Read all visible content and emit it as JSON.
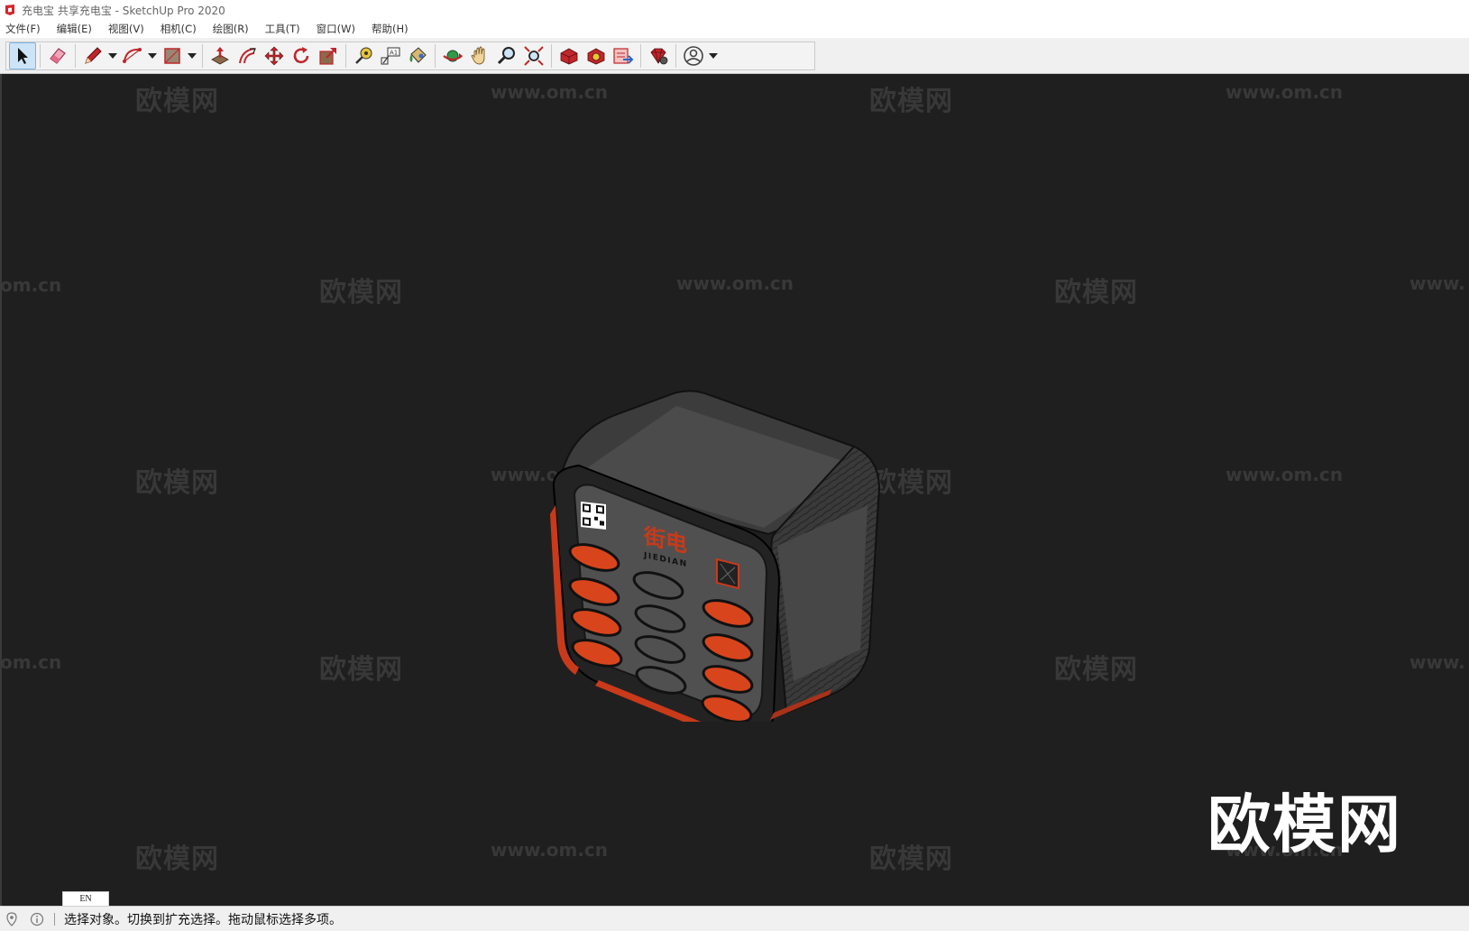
{
  "window": {
    "title": "充电宝 共享充电宝 - SketchUp Pro 2020"
  },
  "menu": {
    "items": [
      {
        "id": "file",
        "label": "文件(F)"
      },
      {
        "id": "edit",
        "label": "编辑(E)"
      },
      {
        "id": "view",
        "label": "视图(V)"
      },
      {
        "id": "camera",
        "label": "相机(C)"
      },
      {
        "id": "draw",
        "label": "绘图(R)"
      },
      {
        "id": "tools",
        "label": "工具(T)"
      },
      {
        "id": "window",
        "label": "窗口(W)"
      },
      {
        "id": "help",
        "label": "帮助(H)"
      }
    ]
  },
  "toolbar": {
    "tools": [
      {
        "name": "select-tool",
        "icon": "arrow-cursor-icon",
        "active": true
      },
      {
        "name": "eraser-tool",
        "icon": "eraser-icon"
      },
      {
        "name": "line-tool",
        "icon": "pencil-icon",
        "has_dropdown": true
      },
      {
        "name": "arc-tool",
        "icon": "arc-icon",
        "has_dropdown": true
      },
      {
        "name": "rectangle-tool",
        "icon": "rectangle-icon",
        "has_dropdown": true
      },
      {
        "name": "push-pull-tool",
        "icon": "push-pull-icon"
      },
      {
        "name": "offset-tool",
        "icon": "offset-icon"
      },
      {
        "name": "move-tool",
        "icon": "move-icon"
      },
      {
        "name": "rotate-tool",
        "icon": "rotate-icon"
      },
      {
        "name": "scale-tool",
        "icon": "scale-icon"
      },
      {
        "name": "tape-measure-tool",
        "icon": "tape-measure-icon"
      },
      {
        "name": "text-tool",
        "icon": "text-label-icon"
      },
      {
        "name": "paint-bucket-tool",
        "icon": "paint-bucket-icon"
      },
      {
        "name": "orbit-tool",
        "icon": "orbit-icon"
      },
      {
        "name": "pan-tool",
        "icon": "hand-icon"
      },
      {
        "name": "zoom-tool",
        "icon": "magnifier-icon"
      },
      {
        "name": "zoom-extents-tool",
        "icon": "zoom-extents-icon"
      },
      {
        "name": "warehouse-tool",
        "icon": "3d-warehouse-icon"
      },
      {
        "name": "extension-warehouse-tool",
        "icon": "extension-warehouse-icon"
      },
      {
        "name": "send-to-layout-tool",
        "icon": "send-to-layout-icon"
      },
      {
        "name": "extension-manager-tool",
        "icon": "ruby-gem-icon"
      },
      {
        "name": "account-tool",
        "icon": "user-account-icon",
        "has_dropdown": true
      }
    ]
  },
  "watermarks": {
    "cn": "欧模网",
    "url": "www.om.cn",
    "url_left_partial": "om.cn",
    "url_right_partial": "www.",
    "big_logo": "欧模网"
  },
  "model": {
    "brand_cn": "街电",
    "brand_en": "JIEDIAN",
    "accent_color": "#e0401a",
    "body_color": "#4a4a4a"
  },
  "ime": {
    "label": "EN"
  },
  "statusbar": {
    "text": "选择对象。切换到扩充选择。拖动鼠标选择多项。"
  }
}
